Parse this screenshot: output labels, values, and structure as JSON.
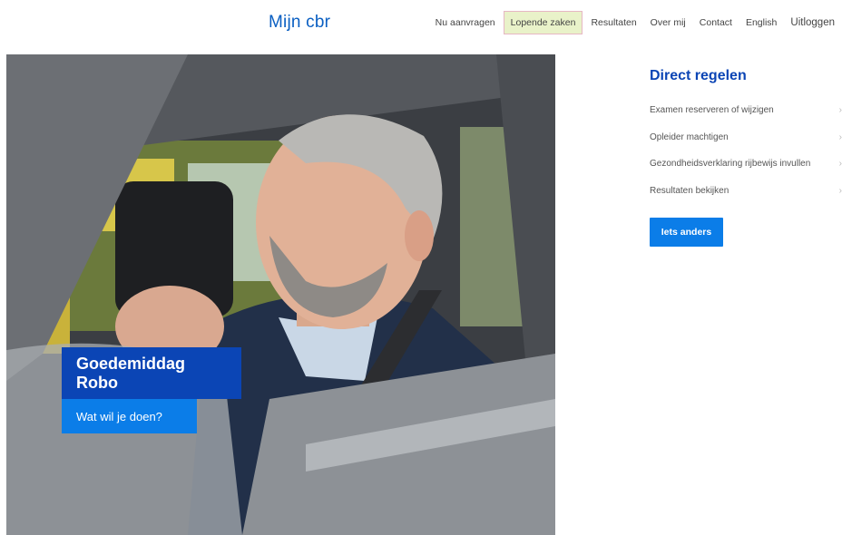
{
  "header": {
    "brand": "Mijn cbr",
    "nav": [
      {
        "label": "Nu aanvragen"
      },
      {
        "label": "Lopende zaken",
        "active": true
      },
      {
        "label": "Resultaten"
      },
      {
        "label": "Over mij"
      },
      {
        "label": "Contact"
      },
      {
        "label": "English"
      },
      {
        "label": "Uitloggen"
      }
    ]
  },
  "hero": {
    "greeting": "Goedemiddag Robo",
    "question": "Wat wil je doen?"
  },
  "quick": {
    "title": "Direct regelen",
    "items": [
      {
        "label": "Examen reserveren of wijzigen"
      },
      {
        "label": "Opleider machtigen"
      },
      {
        "label": "Gezondheidsverklaring rijbewijs invullen"
      },
      {
        "label": "Resultaten bekijken"
      }
    ],
    "chevron": "›",
    "other_button": "Iets anders"
  },
  "colors": {
    "brand": "#0a5fc2",
    "dark_blue": "#0b45b5",
    "button_blue": "#0b7de8",
    "active_tab_bg": "#e9f2c9"
  }
}
